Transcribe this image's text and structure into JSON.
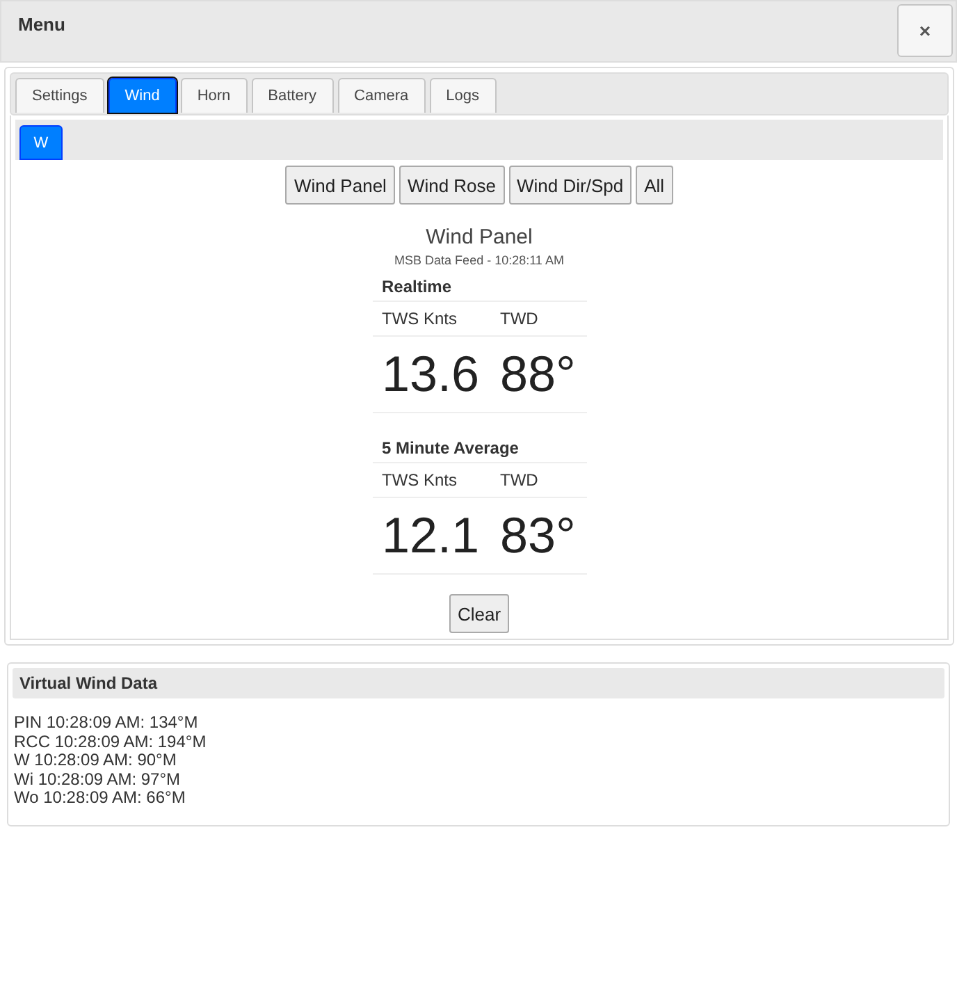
{
  "header": {
    "title": "Menu",
    "close": "×"
  },
  "tabs": [
    {
      "label": "Settings",
      "selected": false
    },
    {
      "label": "Wind",
      "selected": true
    },
    {
      "label": "Horn",
      "selected": false
    },
    {
      "label": "Battery",
      "selected": false
    },
    {
      "label": "Camera",
      "selected": false
    },
    {
      "label": "Logs",
      "selected": false
    }
  ],
  "subtabs": [
    {
      "label": "W",
      "selected": true
    }
  ],
  "view_buttons": [
    "Wind Panel",
    "Wind Rose",
    "Wind Dir/Spd",
    "All"
  ],
  "panel": {
    "title": "Wind Panel",
    "subtitle": "MSB Data Feed - 10:28:11 AM",
    "sections": [
      {
        "heading": "Realtime",
        "columns": [
          "TWS Knts",
          "TWD"
        ],
        "values": [
          "13.6",
          "88°"
        ]
      },
      {
        "heading": "5 Minute Average",
        "columns": [
          "TWS Knts",
          "TWD"
        ],
        "values": [
          "12.1",
          "83°"
        ]
      }
    ],
    "clear_button": "Clear"
  },
  "virtual": {
    "title": "Virtual Wind Data",
    "lines": [
      "PIN 10:28:09 AM: 134°M",
      "RCC 10:28:09 AM: 194°M",
      "W 10:28:09 AM: 90°M",
      "Wi 10:28:09 AM: 97°M",
      "Wo 10:28:09 AM: 66°M"
    ]
  }
}
